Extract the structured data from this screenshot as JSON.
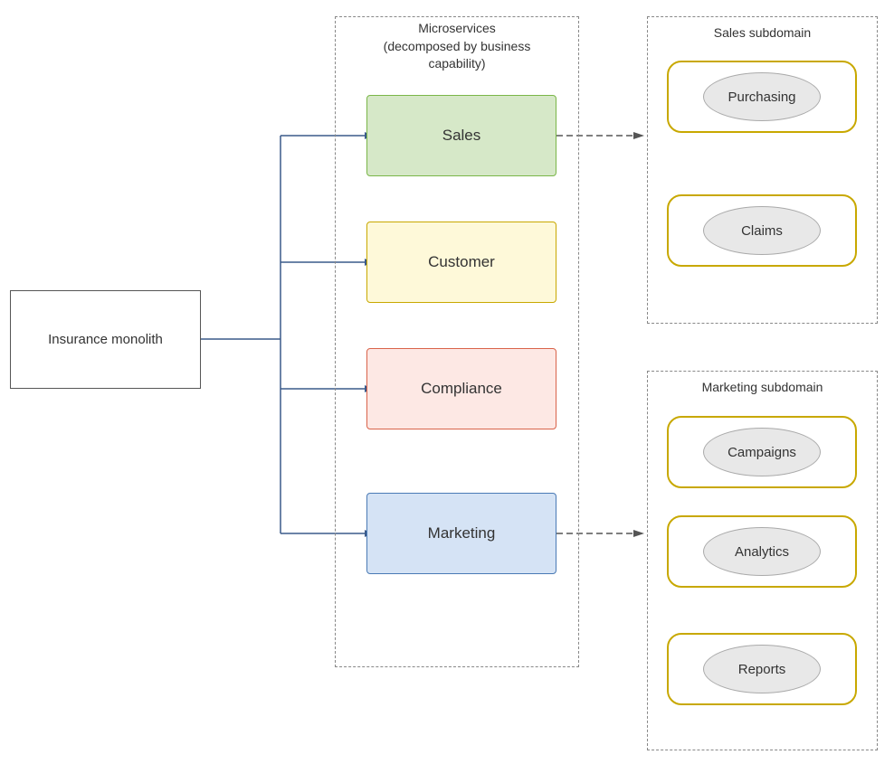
{
  "diagram": {
    "monolith": {
      "label": "Insurance monolith"
    },
    "microservices_title_line1": "Microservices",
    "microservices_title_line2": "(decomposed by business",
    "microservices_title_line3": "capability)",
    "services": [
      {
        "id": "sales",
        "label": "Sales",
        "color_class": "sales-box"
      },
      {
        "id": "customer",
        "label": "Customer",
        "color_class": "customer-box"
      },
      {
        "id": "compliance",
        "label": "Compliance",
        "color_class": "compliance-box"
      },
      {
        "id": "marketing",
        "label": "Marketing",
        "color_class": "marketing-box"
      }
    ],
    "sales_subdomain": {
      "title": "Sales subdomain",
      "items": [
        {
          "id": "purchasing",
          "label": "Purchasing"
        },
        {
          "id": "claims",
          "label": "Claims"
        }
      ]
    },
    "marketing_subdomain": {
      "title": "Marketing subdomain",
      "items": [
        {
          "id": "campaigns",
          "label": "Campaigns"
        },
        {
          "id": "analytics",
          "label": "Analytics"
        },
        {
          "id": "reports",
          "label": "Reports"
        }
      ]
    }
  }
}
